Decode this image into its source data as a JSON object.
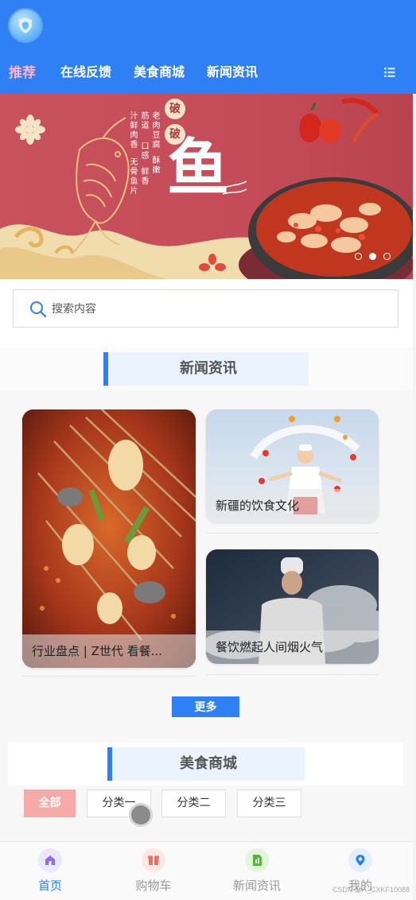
{
  "header": {
    "nav_tabs": [
      "推荐",
      "在线反馈",
      "美食商城",
      "新闻资讯"
    ]
  },
  "banner": {
    "title_char": "鱼",
    "seal_chars": [
      "破",
      "破"
    ],
    "vertical_text": [
      "老肉豆腐",
      "筋道",
      "口感",
      "鲜香",
      "酥嫩",
      "汁鲜肉香",
      "无骨鱼片"
    ],
    "slide_count": 3,
    "active_slide": 2
  },
  "search": {
    "placeholder": "搜索内容"
  },
  "news": {
    "section_title": "新闻资讯",
    "cards": [
      {
        "caption": "行业盘点 | Z世代 看餐..."
      },
      {
        "caption": "新疆的饮食文化"
      },
      {
        "caption": "餐饮燃起人间烟火气"
      }
    ],
    "more_label": "更多"
  },
  "shop": {
    "section_title": "美食商城",
    "categories": [
      "全部",
      "分类一",
      "分类二",
      "分类三"
    ]
  },
  "tabbar": {
    "items": [
      {
        "label": "首页",
        "icon": "home-icon",
        "color": "#8a6cf5"
      },
      {
        "label": "购物车",
        "icon": "cart-icon",
        "color": "#f36b5f"
      },
      {
        "label": "新闻资讯",
        "icon": "news-icon",
        "color": "#52b83a"
      },
      {
        "label": "我的",
        "icon": "profile-icon",
        "color": "#2f7ff5"
      }
    ]
  },
  "watermark": "CSDN @A_CXKF10088",
  "colors": {
    "accent": "#2f7ff5",
    "active_tab_text": "#ffb3cf",
    "category_active": "#f6aaa8"
  }
}
